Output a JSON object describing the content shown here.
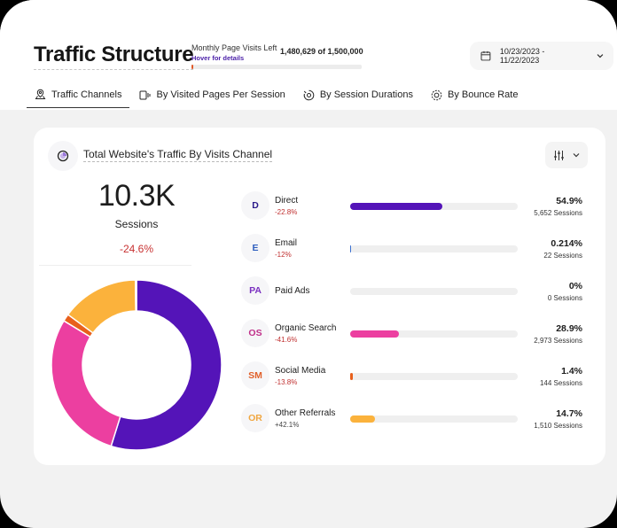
{
  "header": {
    "title": "Traffic Structure",
    "quota": {
      "label": "Monthly Page Visits Left",
      "hover": "Hover for details",
      "value": "1,480,629 of 1,500,000",
      "used_fraction": 0.0129,
      "fill_color": "#e05a2a"
    },
    "date_range": "10/23/2023 - 11/22/2023"
  },
  "tabs": [
    {
      "label": "Traffic Channels",
      "icon": "location-pin-icon",
      "active": true
    },
    {
      "label": "By Visited Pages Per Session",
      "icon": "pages-icon",
      "active": false
    },
    {
      "label": "By Session Durations",
      "icon": "timer-icon",
      "active": false
    },
    {
      "label": "By Bounce Rate",
      "icon": "target-icon",
      "active": false
    }
  ],
  "card": {
    "title": "Total Website's Traffic By Visits Channel",
    "total": "10.3K",
    "total_label": "Sessions",
    "total_change": "-24.6%"
  },
  "channels": [
    {
      "abbr": "D",
      "name": "Direct",
      "change": "-22.8%",
      "positive": false,
      "pct": "54.9%",
      "value": 54.9,
      "sessions": "5,652 Sessions",
      "color": "#5414b8",
      "abbr_color": "#2a1a8a"
    },
    {
      "abbr": "E",
      "name": "Email",
      "change": "-12%",
      "positive": false,
      "pct": "0.214%",
      "value": 0.214,
      "sessions": "22 Sessions",
      "color": "#3a6fd0",
      "abbr_color": "#2f5fbf"
    },
    {
      "abbr": "PA",
      "name": "Paid Ads",
      "change": "",
      "positive": false,
      "pct": "0%",
      "value": 0,
      "sessions": "0 Sessions",
      "color": "#7a2fc0",
      "abbr_color": "#7a2fc0"
    },
    {
      "abbr": "OS",
      "name": "Organic Search",
      "change": "-41.6%",
      "positive": false,
      "pct": "28.9%",
      "value": 28.9,
      "sessions": "2,973 Sessions",
      "color": "#ec3fa0",
      "abbr_color": "#c0308a"
    },
    {
      "abbr": "SM",
      "name": "Social Media",
      "change": "-13.8%",
      "positive": false,
      "pct": "1.4%",
      "value": 1.4,
      "sessions": "144 Sessions",
      "color": "#e8601c",
      "abbr_color": "#e0602a"
    },
    {
      "abbr": "OR",
      "name": "Other Referrals",
      "change": "+42.1%",
      "positive": true,
      "pct": "14.7%",
      "value": 14.7,
      "sessions": "1,510 Sessions",
      "color": "#fbb23c",
      "abbr_color": "#f0a640"
    }
  ]
}
